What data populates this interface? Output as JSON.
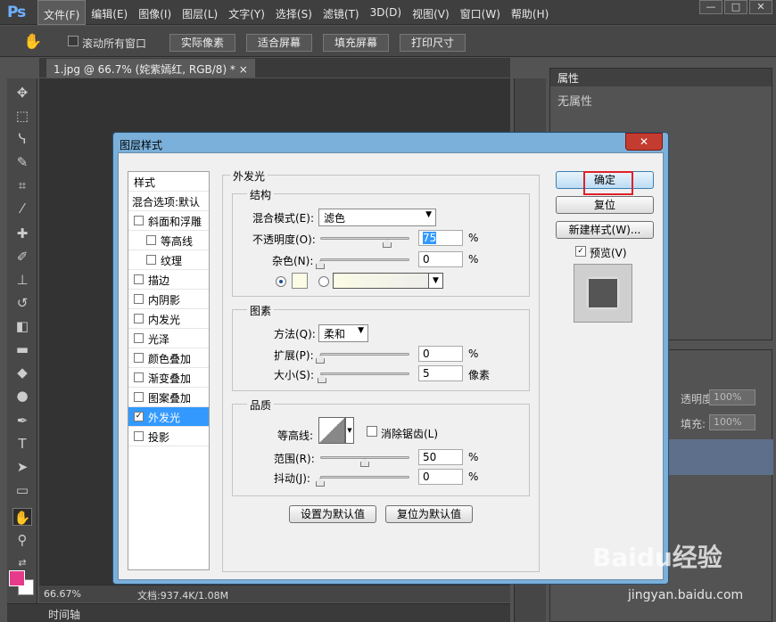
{
  "app": {
    "logo": "Ps"
  },
  "menubar": [
    "文件(F)",
    "编辑(E)",
    "图像(I)",
    "图层(L)",
    "文字(Y)",
    "选择(S)",
    "滤镜(T)",
    "3D(D)",
    "视图(V)",
    "窗口(W)",
    "帮助(H)"
  ],
  "window_buttons": [
    "—",
    "□",
    "✕"
  ],
  "options_bar": {
    "scroll_all": "滚动所有窗口",
    "actual_pixels": "实际像素",
    "fit_screen": "适合屏幕",
    "fill_screen": "填充屏幕",
    "print_size": "打印尺寸"
  },
  "document_tab": "1.jpg @ 66.7% (姹紫嫣红, RGB/8) *  ×",
  "status": {
    "zoom": "66.67%",
    "doc": "文档:937.4K/1.08M"
  },
  "timeline": "时间轴",
  "properties_panel": {
    "title": "属性",
    "empty": "无属性"
  },
  "layers_panel": {
    "opacity_label": "透明度:",
    "opacity_value": "100%",
    "fill_label": "填充:",
    "fill_value": "100%"
  },
  "dialog": {
    "title": "图层样式",
    "close": "✕",
    "styles_header": "样式",
    "blend_options": "混合选项:默认",
    "style_items": [
      {
        "label": "斜面和浮雕",
        "checked": false,
        "indent": false
      },
      {
        "label": "等高线",
        "checked": false,
        "indent": true
      },
      {
        "label": "纹理",
        "checked": false,
        "indent": true
      },
      {
        "label": "描边",
        "checked": false,
        "indent": false
      },
      {
        "label": "内阴影",
        "checked": false,
        "indent": false
      },
      {
        "label": "内发光",
        "checked": false,
        "indent": false
      },
      {
        "label": "光泽",
        "checked": false,
        "indent": false
      },
      {
        "label": "颜色叠加",
        "checked": false,
        "indent": false
      },
      {
        "label": "渐变叠加",
        "checked": false,
        "indent": false
      },
      {
        "label": "图案叠加",
        "checked": false,
        "indent": false
      },
      {
        "label": "外发光",
        "checked": true,
        "indent": false
      },
      {
        "label": "投影",
        "checked": false,
        "indent": false
      }
    ],
    "outer_glow": {
      "title": "外发光",
      "structure": {
        "title": "结构",
        "blend_mode_label": "混合模式(E):",
        "blend_mode": "滤色",
        "opacity_label": "不透明度(O):",
        "opacity": "75",
        "opacity_pct": 0.75,
        "noise_label": "杂色(N):",
        "noise": "0",
        "noise_pct": 0,
        "unit": "%"
      },
      "elements": {
        "title": "图素",
        "technique_label": "方法(Q):",
        "technique": "柔和",
        "spread_label": "扩展(P):",
        "spread": "0",
        "spread_pct": 0,
        "size_label": "大小(S):",
        "size": "5",
        "size_pct": 0.02,
        "unit_pct": "%",
        "unit_px": "像素"
      },
      "quality": {
        "title": "品质",
        "contour_label": "等高线:",
        "antialias_label": "消除锯齿(L)",
        "range_label": "范围(R):",
        "range": "50",
        "range_pct": 0.5,
        "jitter_label": "抖动(J):",
        "jitter": "0",
        "jitter_pct": 0,
        "unit": "%"
      },
      "make_default": "设置为默认值",
      "reset_default": "复位为默认值"
    },
    "buttons": {
      "ok": "确定",
      "reset": "复位",
      "new_style": "新建样式(W)...",
      "preview": "预览(V)"
    }
  },
  "watermark": {
    "brand": "Baidu经验",
    "url": "jingyan.baidu.com"
  },
  "colors": {
    "foreground": "#e63a8a",
    "background": "#ffffff",
    "selection": "#3399ff",
    "highlight_box": "#e0202a"
  }
}
